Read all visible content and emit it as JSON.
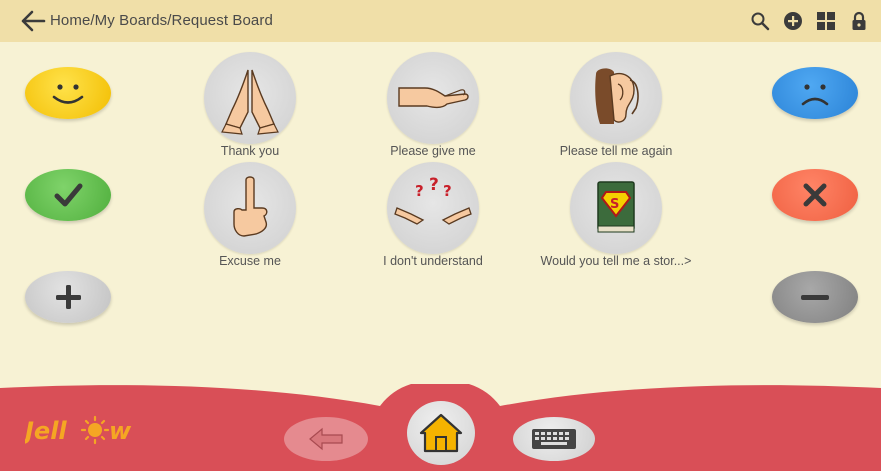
{
  "header": {
    "breadcrumb": "Home/My Boards/Request Board",
    "icons": [
      "back-arrow-icon",
      "search-icon",
      "add-icon",
      "grid-icon",
      "lock-icon"
    ]
  },
  "tiles": [
    {
      "label": "Thank you",
      "icon": "folded-hands-icon"
    },
    {
      "label": "Please give me",
      "icon": "open-hand-icon"
    },
    {
      "label": "Please tell me again",
      "icon": "ear-icon"
    },
    {
      "label": "Excuse me",
      "icon": "raised-finger-icon"
    },
    {
      "label": "I don't understand",
      "icon": "question-hands-icon"
    },
    {
      "label": "Would you tell me a stor...>",
      "icon": "storybook-icon"
    }
  ],
  "side_buttons": {
    "left": [
      "like-smiley",
      "yes-check",
      "more-plus"
    ],
    "right": [
      "dislike-frown",
      "no-cross",
      "less-minus"
    ]
  },
  "bottom": {
    "logo": "Jellow",
    "buttons": [
      "back-button",
      "home-button",
      "keyboard-button"
    ]
  },
  "colors": {
    "header": "#f0dfa8",
    "board": "#f7f2d4",
    "bottom_bar": "#d94f57",
    "like": "#f5c400",
    "yes": "#5db84a",
    "dislike": "#2f8de0",
    "no": "#f26648",
    "more": "#c9c9c9",
    "less": "#8a8a8a",
    "logo": "#f5a623"
  }
}
